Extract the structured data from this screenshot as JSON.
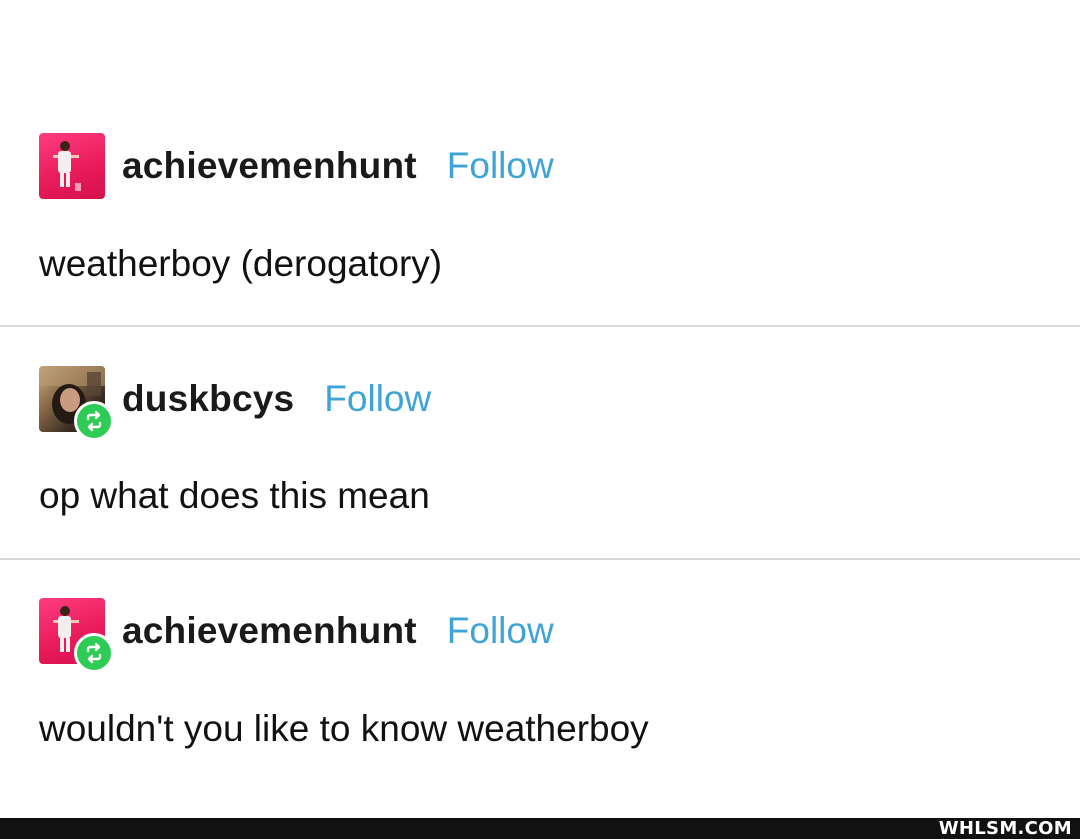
{
  "thread": {
    "posts": [
      {
        "username": "achievemenhunt",
        "follow_label": "Follow",
        "text": "weatherboy (derogatory)",
        "avatar": "pink-avatar-person",
        "reblog_badge": false
      },
      {
        "username": "duskbcys",
        "follow_label": "Follow",
        "text": "op what does this mean",
        "avatar": "photo-avatar-person",
        "reblog_badge": true
      },
      {
        "username": "achievemenhunt",
        "follow_label": "Follow",
        "text": "wouldn't you like to know weatherboy",
        "avatar": "pink-avatar-person",
        "reblog_badge": true
      }
    ]
  },
  "watermark": {
    "text": "WHLSM.COM"
  },
  "colors": {
    "follow": "#3ea3d6",
    "reblog_badge": "#2fcc55",
    "avatar_pink": "#e81a5a",
    "divider": "#d9d9d9"
  }
}
